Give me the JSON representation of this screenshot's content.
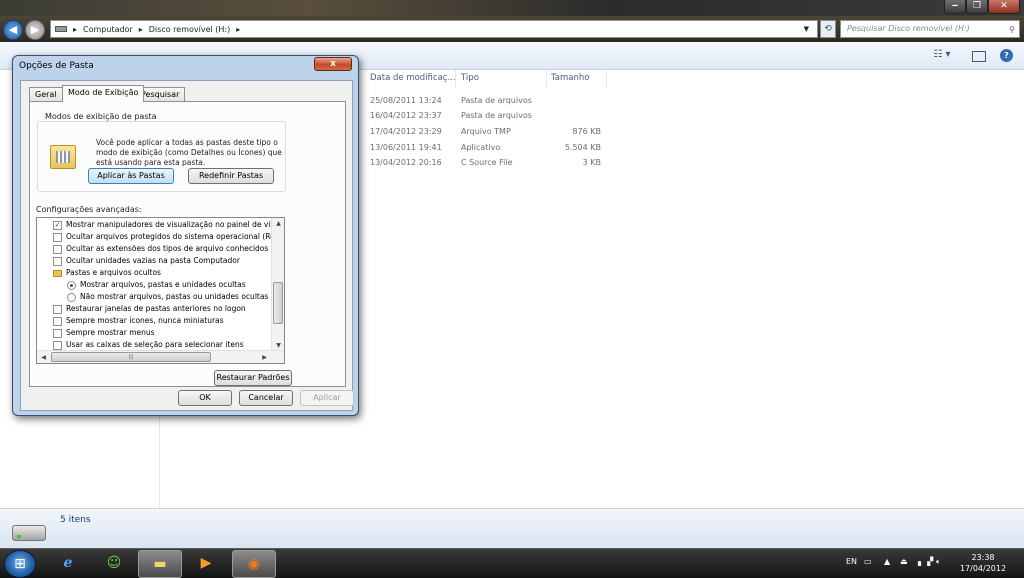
{
  "window": {
    "caption_buttons": [
      "‒",
      "❐",
      "✕"
    ]
  },
  "address_bar": {
    "segments": [
      "Computador",
      "Disco removível (H:)"
    ],
    "search_placeholder": "Pesquisar Disco removível (H:)"
  },
  "file_list": {
    "columns": [
      "Data de modificaç...",
      "Tipo",
      "Tamanho"
    ],
    "rows": [
      {
        "date": "25/08/2011 13:24",
        "type": "Pasta de arquivos",
        "size": ""
      },
      {
        "date": "16/04/2012 23:37",
        "type": "Pasta de arquivos",
        "size": ""
      },
      {
        "date": "17/04/2012 23:29",
        "type": "Arquivo TMP",
        "size": "876 KB"
      },
      {
        "date": "13/06/2011 19:41",
        "type": "Aplicativo",
        "size": "5.504 KB"
      },
      {
        "date": "13/04/2012 20:16",
        "type": "C Source File",
        "size": "3 KB"
      }
    ]
  },
  "status_bar": {
    "item_count": "5 itens"
  },
  "dialog": {
    "title": "Opções de Pasta",
    "close_label": "x",
    "tabs": [
      "Geral",
      "Modo de Exibição",
      "Pesquisar"
    ],
    "selected_tab": 1,
    "group_title": "Modos de exibição de pasta",
    "group_description": "Você pode aplicar a todas as pastas deste tipo o modo de exibição (como Detalhes ou Ícones) que está usando para esta pasta.",
    "apply_to_folders": "Aplicar às Pastas",
    "reset_folders": "Redefinir Pastas",
    "advanced_label": "Configurações avançadas:",
    "advanced_items": [
      {
        "kind": "check",
        "checked": true,
        "label": "Mostrar manipuladores de visualização no painel de visua"
      },
      {
        "kind": "check",
        "checked": false,
        "label": "Ocultar arquivos protegidos do sistema operacional (Reco"
      },
      {
        "kind": "check",
        "checked": false,
        "label": "Ocultar as extensões dos tipos de arquivo conhecidos"
      },
      {
        "kind": "check",
        "checked": false,
        "label": "Ocultar unidades vazias na pasta Computador"
      },
      {
        "kind": "folder",
        "label": "Pastas e arquivos ocultos"
      },
      {
        "kind": "radio",
        "checked": true,
        "label": "Mostrar arquivos, pastas e unidades ocultas"
      },
      {
        "kind": "radio",
        "checked": false,
        "label": "Não mostrar arquivos, pastas ou unidades ocultas"
      },
      {
        "kind": "check",
        "checked": false,
        "label": "Restaurar janelas de pastas anteriores no logon"
      },
      {
        "kind": "check",
        "checked": false,
        "label": "Sempre mostrar ícones, nunca miniaturas"
      },
      {
        "kind": "check",
        "checked": false,
        "label": "Sempre mostrar menus"
      },
      {
        "kind": "check",
        "checked": false,
        "label": "Usar as caixas de seleção para selecionar itens"
      }
    ],
    "restore_defaults": "Restaurar Padrões",
    "ok": "OK",
    "cancel": "Cancelar",
    "apply": "Aplicar"
  },
  "taskbar": {
    "language": "EN",
    "time": "23:38",
    "date": "17/04/2012"
  }
}
